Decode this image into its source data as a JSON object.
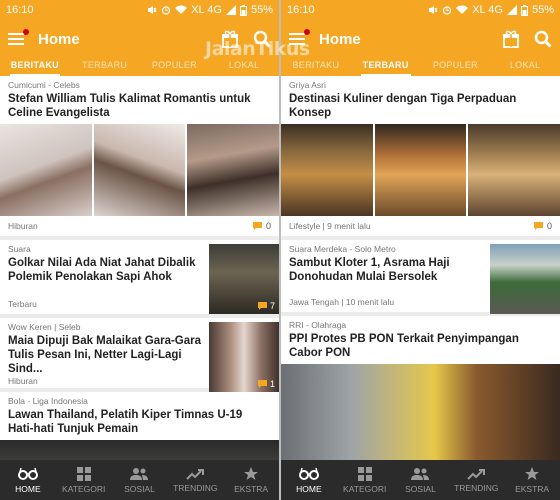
{
  "watermark": "JalanTikus",
  "colors": {
    "brand": "#f5a623",
    "nav_bg": "#2b2b2b",
    "comment_icon": "#f5a623"
  },
  "left": {
    "status": {
      "time": "16:10",
      "network": "XL 4G",
      "battery": "55%"
    },
    "appbar": {
      "title": "Home",
      "icons": [
        "menu-icon",
        "gift-icon",
        "search-icon"
      ]
    },
    "tabs": [
      {
        "label": "BERITAKU",
        "active": true
      },
      {
        "label": "TERBARU",
        "active": false
      },
      {
        "label": "POPULER",
        "active": false
      },
      {
        "label": "LOKAL",
        "active": false
      }
    ],
    "cards": [
      {
        "source": "Cumicumi - Celebs",
        "headline": "Stefan William Tulis Kalimat Romantis untuk Celine Evangelista",
        "meta": "Hiburan",
        "comments": "0"
      },
      {
        "source": "Suara",
        "headline": "Golkar Nilai Ada Niat Jahat Dibalik Polemik Penolakan Sapi Ahok",
        "meta": "Terbaru",
        "comments": "7"
      },
      {
        "source": "Wow Keren | Seleb",
        "headline": "Maia Dipuji Bak Malaikat Gara-Gara Tulis Pesan Ini, Netter Lagi-Lagi Sind...",
        "meta": "Hiburan",
        "comments": "1"
      },
      {
        "source": "Bola - Liga Indonesia",
        "headline": "Lawan Thailand, Pelatih Kiper Timnas U-19 Hati-hati Tunjuk Pemain"
      }
    ],
    "nav": [
      {
        "label": "HOME",
        "icon": "glasses-icon",
        "active": true
      },
      {
        "label": "KATEGORI",
        "icon": "grid-icon",
        "active": false
      },
      {
        "label": "SOSIAL",
        "icon": "people-icon",
        "active": false
      },
      {
        "label": "TRENDING",
        "icon": "trending-icon",
        "active": false
      },
      {
        "label": "EKSTRA",
        "icon": "star-icon",
        "active": false
      }
    ]
  },
  "right": {
    "status": {
      "time": "16:10",
      "network": "XL 4G",
      "battery": "55%"
    },
    "appbar": {
      "title": "Home",
      "icons": [
        "menu-icon",
        "gift-icon",
        "search-icon"
      ]
    },
    "tabs": [
      {
        "label": "BERITAKU",
        "active": false
      },
      {
        "label": "TERBARU",
        "active": true
      },
      {
        "label": "POPULER",
        "active": false
      },
      {
        "label": "LOKAL",
        "active": false
      }
    ],
    "cards": [
      {
        "source": "Griya Asri",
        "headline": "Destinasi Kuliner dengan Tiga Perpaduan Konsep",
        "meta": "Lifestyle | 9 menit lalu",
        "comments": "0"
      },
      {
        "source": "Suara Merdeka - Solo Metro",
        "headline": "Sambut Kloter 1, Asrama Haji Donohudan Mulai Bersolek",
        "meta": "Jawa Tengah | 10 menit lalu"
      },
      {
        "source": "RRI - Olahraga",
        "headline": "PPI Protes PB PON Terkait Penyimpangan Cabor PON"
      }
    ],
    "nav": [
      {
        "label": "HOME",
        "icon": "glasses-icon",
        "active": true
      },
      {
        "label": "KATEGORI",
        "icon": "grid-icon",
        "active": false
      },
      {
        "label": "SOSIAL",
        "icon": "people-icon",
        "active": false
      },
      {
        "label": "TRENDING",
        "icon": "trending-icon",
        "active": false
      },
      {
        "label": "EKSTRA",
        "icon": "star-icon",
        "active": false
      }
    ]
  }
}
